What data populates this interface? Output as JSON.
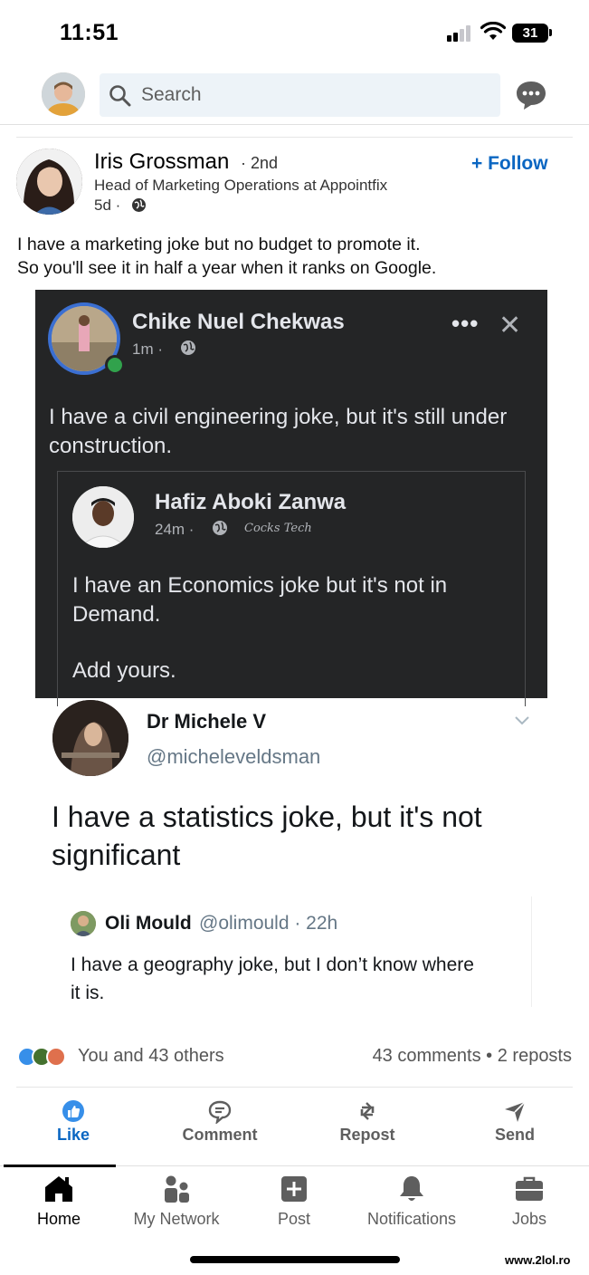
{
  "status_bar": {
    "time": "11:51",
    "battery": "31"
  },
  "top_nav": {
    "search_placeholder": "Search"
  },
  "post": {
    "author": "Iris Grossman",
    "degree": "· 2nd",
    "headline": "Head of Marketing Operations at Appointfix",
    "time": "5d ·",
    "follow_label": "+ Follow",
    "text_line1": "I have a marketing joke but no budget to promote it.",
    "text_line2": "So you'll see it in half a year when it ranks on Google."
  },
  "image": {
    "fb_post": {
      "author": "Chike Nuel Chekwas",
      "time": "1m ·",
      "dots": "•••",
      "close": "✕",
      "text": "I have a civil engineering joke, but it's still under construction.",
      "shared": {
        "author": "Hafiz Aboki Zanwa",
        "time": "24m ·",
        "signature": "Cocks Tech",
        "text": "I have an Economics joke but it's not in Demand.",
        "text2": "Add yours."
      }
    },
    "tweet": {
      "author": "Dr Michele V",
      "handle": "@micheleveldsman",
      "text": "I have a statistics joke, but it's not significant",
      "quote": {
        "author": "Oli Mould",
        "handle": "@olimould · 22h",
        "text": "I have a geography joke, but I don’t know where it is."
      }
    }
  },
  "social": {
    "reactions_text": "You and 43 others",
    "counts_text": "43 comments  •  2 reposts"
  },
  "actions": [
    {
      "label": "Like",
      "icon": "thumbs-up-icon"
    },
    {
      "label": "Comment",
      "icon": "comment-icon"
    },
    {
      "label": "Repost",
      "icon": "repost-icon"
    },
    {
      "label": "Send",
      "icon": "send-icon"
    }
  ],
  "tabs": [
    {
      "label": "Home",
      "icon": "home-icon"
    },
    {
      "label": "My Network",
      "icon": "network-icon"
    },
    {
      "label": "Post",
      "icon": "post-icon"
    },
    {
      "label": "Notifications",
      "icon": "bell-icon"
    },
    {
      "label": "Jobs",
      "icon": "briefcase-icon"
    }
  ],
  "watermark": "www.2lol.ro",
  "colors": {
    "accent": "#0a66c2",
    "fb_bg": "#242526",
    "search_bg": "#edf3f8"
  }
}
